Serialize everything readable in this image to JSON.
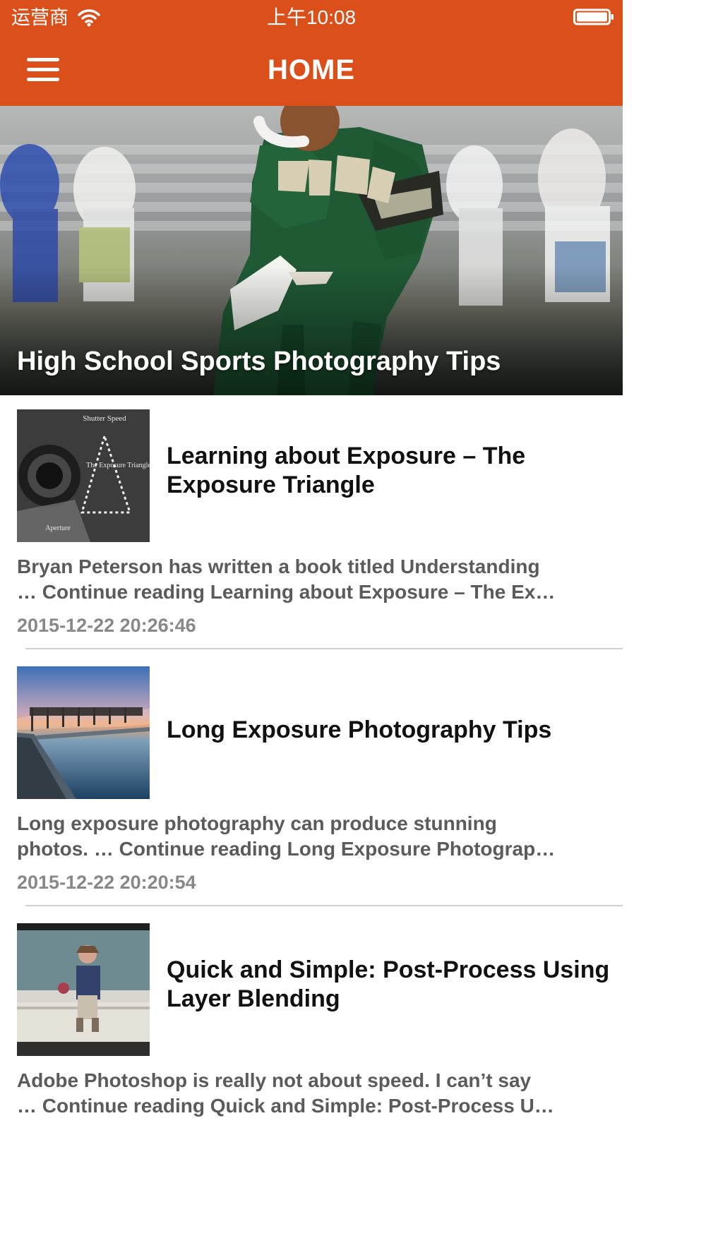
{
  "status_bar": {
    "carrier": "运营商",
    "time": "上午10:08"
  },
  "header": {
    "title": "HOME"
  },
  "hero": {
    "title": "High School Sports Photography Tips"
  },
  "articles": [
    {
      "title": "Learning about Exposure – The Exposure Triangle",
      "title_line1": "Learning about Exposure – The",
      "title_line2": "Exposure Triangle",
      "excerpt_line1": "Bryan Peterson has written a book titled Understanding",
      "excerpt_line2": "… Continue reading Learning about Exposure – The Ex…",
      "date": "2015-12-22 20:26:46",
      "thumb_caption_top": "Shutter Speed",
      "thumb_caption_center": "The Exposure Triangle",
      "thumb_caption_bottom": "Aperture"
    },
    {
      "title": "Long Exposure Photography Tips",
      "excerpt_line1": "Long exposure photography can produce stunning",
      "excerpt_line2": "photos. … Continue reading Long Exposure Photograp…",
      "date": "2015-12-22 20:20:54"
    },
    {
      "title": "Quick and Simple: Post-Process Using Layer Blending",
      "title_line1": "Quick and Simple: Post-Process Using",
      "title_line2": "Layer Blending",
      "excerpt_line1": "Adobe Photoshop is really not about speed. I can’t say",
      "excerpt_line2": "… Continue reading Quick and Simple: Post-Process U…"
    }
  ],
  "colors": {
    "accent": "#db4f1b",
    "title": "#111111",
    "excerpt": "#5b5b5b",
    "date": "#888888",
    "divider": "#d0d0d0"
  },
  "icons": {
    "wifi": "wifi-icon",
    "battery": "battery-icon",
    "menu": "hamburger-menu-icon"
  }
}
